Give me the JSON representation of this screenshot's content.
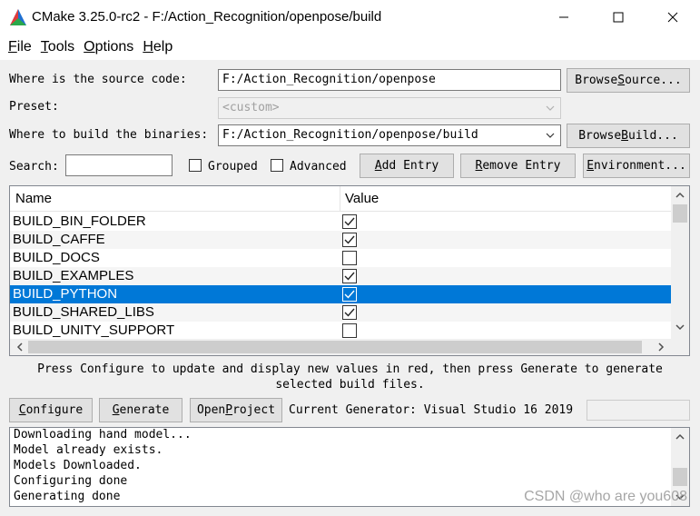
{
  "window": {
    "title": "CMake 3.25.0-rc2 - F:/Action_Recognition/openpose/build"
  },
  "menu": [
    {
      "key": "F",
      "rest": "ile"
    },
    {
      "key": "T",
      "rest": "ools"
    },
    {
      "key": "O",
      "rest": "ptions"
    },
    {
      "key": "H",
      "rest": "elp"
    }
  ],
  "source": {
    "label": "Where is the source code:",
    "value": "F:/Action_Recognition/openpose",
    "browse_pre": "Browse ",
    "browse_key": "S",
    "browse_post": "ource..."
  },
  "preset": {
    "label": "Preset:",
    "value": "<custom>"
  },
  "binaries": {
    "label": "Where to build the binaries:",
    "value": "F:/Action_Recognition/openpose/build",
    "browse_pre": "Browse ",
    "browse_key": "B",
    "browse_post": "uild..."
  },
  "search": {
    "label": "Search:",
    "value": ""
  },
  "options": {
    "grouped": "Grouped",
    "advanced": "Advanced",
    "add_entry_key": "A",
    "add_entry_rest": "dd Entry",
    "remove_entry_key": "R",
    "remove_entry_rest": "emove Entry",
    "environment_key": "E",
    "environment_rest": "nvironment..."
  },
  "table": {
    "columns": [
      "Name",
      "Value"
    ],
    "rows": [
      {
        "name": "BUILD_BIN_FOLDER",
        "checked": true
      },
      {
        "name": "BUILD_CAFFE",
        "checked": true
      },
      {
        "name": "BUILD_DOCS",
        "checked": false
      },
      {
        "name": "BUILD_EXAMPLES",
        "checked": true
      },
      {
        "name": "BUILD_PYTHON",
        "checked": true,
        "selected": true
      },
      {
        "name": "BUILD_SHARED_LIBS",
        "checked": true
      },
      {
        "name": "BUILD_UNITY_SUPPORT",
        "checked": false
      }
    ]
  },
  "hint": {
    "line1": "Press Configure to update and display new values in red, then press Generate to generate",
    "line2": "selected build files."
  },
  "actions": {
    "configure_key": "C",
    "configure_rest": "onfigure",
    "generate_key": "G",
    "generate_rest": "enerate",
    "open_project_pre": "Open ",
    "open_project_key": "P",
    "open_project_post": "roject",
    "current_generator": "Current Generator: Visual Studio 16 2019"
  },
  "log": [
    "Downloading hand model...",
    "Model already exists.",
    "Models Downloaded.",
    "Configuring done",
    "Generating done"
  ],
  "watermark": "CSDN @who are you608",
  "colors": {
    "selection": "#0078d7"
  }
}
